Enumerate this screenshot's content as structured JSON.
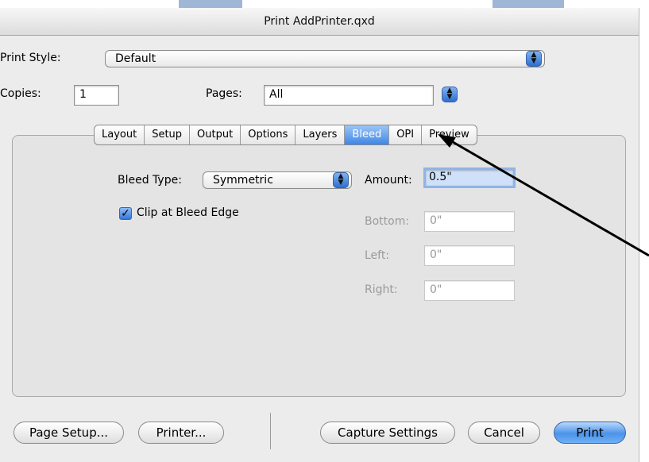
{
  "window": {
    "title": "Print AddPrinter.qxd"
  },
  "print_style": {
    "label": "Print Style:",
    "value": "Default"
  },
  "copies": {
    "label": "Copies:",
    "value": "1"
  },
  "pages": {
    "label": "Pages:",
    "value": "All"
  },
  "tabs": [
    {
      "label": "Layout",
      "selected": false
    },
    {
      "label": "Setup",
      "selected": false
    },
    {
      "label": "Output",
      "selected": false
    },
    {
      "label": "Options",
      "selected": false
    },
    {
      "label": "Layers",
      "selected": false
    },
    {
      "label": "Bleed",
      "selected": true
    },
    {
      "label": "OPI",
      "selected": false
    },
    {
      "label": "Preview",
      "selected": false
    }
  ],
  "bleed": {
    "type_label": "Bleed Type:",
    "type_value": "Symmetric",
    "clip_label": "Clip at Bleed Edge",
    "clip_checked": true,
    "amount_label": "Amount:",
    "amount_value": "0.5\"",
    "bottom_label": "Bottom:",
    "bottom_value": "0\"",
    "left_label": "Left:",
    "left_value": "0\"",
    "right_label": "Right:",
    "right_value": "0\""
  },
  "buttons": {
    "page_setup": "Page Setup...",
    "printer": "Printer...",
    "capture_settings": "Capture Settings",
    "cancel": "Cancel",
    "print": "Print"
  },
  "colors": {
    "accent": "#3f86e6",
    "focus_ring": "#8fb4e8"
  }
}
